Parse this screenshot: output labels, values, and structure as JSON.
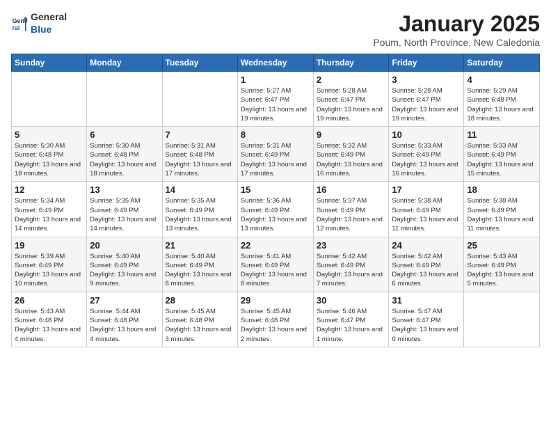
{
  "logo": {
    "general": "General",
    "blue": "Blue"
  },
  "title": {
    "month": "January 2025",
    "location": "Poum, North Province, New Caledonia"
  },
  "weekdays": [
    "Sunday",
    "Monday",
    "Tuesday",
    "Wednesday",
    "Thursday",
    "Friday",
    "Saturday"
  ],
  "weeks": [
    [
      null,
      null,
      null,
      {
        "day": 1,
        "sunrise": "5:27 AM",
        "sunset": "6:47 PM",
        "daylight": "13 hours and 19 minutes."
      },
      {
        "day": 2,
        "sunrise": "5:28 AM",
        "sunset": "6:47 PM",
        "daylight": "13 hours and 19 minutes."
      },
      {
        "day": 3,
        "sunrise": "5:28 AM",
        "sunset": "6:47 PM",
        "daylight": "13 hours and 19 minutes."
      },
      {
        "day": 4,
        "sunrise": "5:29 AM",
        "sunset": "6:48 PM",
        "daylight": "13 hours and 18 minutes."
      }
    ],
    [
      {
        "day": 5,
        "sunrise": "5:30 AM",
        "sunset": "6:48 PM",
        "daylight": "13 hours and 18 minutes."
      },
      {
        "day": 6,
        "sunrise": "5:30 AM",
        "sunset": "6:48 PM",
        "daylight": "13 hours and 18 minutes."
      },
      {
        "day": 7,
        "sunrise": "5:31 AM",
        "sunset": "6:48 PM",
        "daylight": "13 hours and 17 minutes."
      },
      {
        "day": 8,
        "sunrise": "5:31 AM",
        "sunset": "6:49 PM",
        "daylight": "13 hours and 17 minutes."
      },
      {
        "day": 9,
        "sunrise": "5:32 AM",
        "sunset": "6:49 PM",
        "daylight": "13 hours and 16 minutes."
      },
      {
        "day": 10,
        "sunrise": "5:33 AM",
        "sunset": "6:49 PM",
        "daylight": "13 hours and 16 minutes."
      },
      {
        "day": 11,
        "sunrise": "5:33 AM",
        "sunset": "6:49 PM",
        "daylight": "13 hours and 15 minutes."
      }
    ],
    [
      {
        "day": 12,
        "sunrise": "5:34 AM",
        "sunset": "6:49 PM",
        "daylight": "13 hours and 14 minutes."
      },
      {
        "day": 13,
        "sunrise": "5:35 AM",
        "sunset": "6:49 PM",
        "daylight": "13 hours and 14 minutes."
      },
      {
        "day": 14,
        "sunrise": "5:35 AM",
        "sunset": "6:49 PM",
        "daylight": "13 hours and 13 minutes."
      },
      {
        "day": 15,
        "sunrise": "5:36 AM",
        "sunset": "6:49 PM",
        "daylight": "13 hours and 13 minutes."
      },
      {
        "day": 16,
        "sunrise": "5:37 AM",
        "sunset": "6:49 PM",
        "daylight": "13 hours and 12 minutes."
      },
      {
        "day": 17,
        "sunrise": "5:38 AM",
        "sunset": "6:49 PM",
        "daylight": "13 hours and 11 minutes."
      },
      {
        "day": 18,
        "sunrise": "5:38 AM",
        "sunset": "6:49 PM",
        "daylight": "13 hours and 11 minutes."
      }
    ],
    [
      {
        "day": 19,
        "sunrise": "5:39 AM",
        "sunset": "6:49 PM",
        "daylight": "13 hours and 10 minutes."
      },
      {
        "day": 20,
        "sunrise": "5:40 AM",
        "sunset": "6:49 PM",
        "daylight": "13 hours and 9 minutes."
      },
      {
        "day": 21,
        "sunrise": "5:40 AM",
        "sunset": "6:49 PM",
        "daylight": "13 hours and 8 minutes."
      },
      {
        "day": 22,
        "sunrise": "5:41 AM",
        "sunset": "6:49 PM",
        "daylight": "13 hours and 8 minutes."
      },
      {
        "day": 23,
        "sunrise": "5:42 AM",
        "sunset": "6:49 PM",
        "daylight": "13 hours and 7 minutes."
      },
      {
        "day": 24,
        "sunrise": "5:42 AM",
        "sunset": "6:49 PM",
        "daylight": "13 hours and 6 minutes."
      },
      {
        "day": 25,
        "sunrise": "5:43 AM",
        "sunset": "6:49 PM",
        "daylight": "13 hours and 5 minutes."
      }
    ],
    [
      {
        "day": 26,
        "sunrise": "5:43 AM",
        "sunset": "6:48 PM",
        "daylight": "13 hours and 4 minutes."
      },
      {
        "day": 27,
        "sunrise": "5:44 AM",
        "sunset": "6:48 PM",
        "daylight": "13 hours and 4 minutes."
      },
      {
        "day": 28,
        "sunrise": "5:45 AM",
        "sunset": "6:48 PM",
        "daylight": "13 hours and 3 minutes."
      },
      {
        "day": 29,
        "sunrise": "5:45 AM",
        "sunset": "6:48 PM",
        "daylight": "13 hours and 2 minutes."
      },
      {
        "day": 30,
        "sunrise": "5:46 AM",
        "sunset": "6:47 PM",
        "daylight": "13 hours and 1 minute."
      },
      {
        "day": 31,
        "sunrise": "5:47 AM",
        "sunset": "6:47 PM",
        "daylight": "13 hours and 0 minutes."
      },
      null
    ]
  ]
}
